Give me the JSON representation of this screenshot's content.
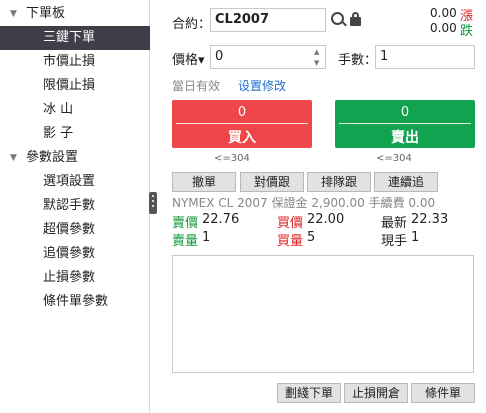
{
  "sidebar": {
    "groups": [
      {
        "label": "下單板",
        "items": [
          "三鍵下單",
          "市價止損",
          "限價止損",
          "冰 山",
          "影 子"
        ]
      },
      {
        "label": "參數設置",
        "items": [
          "選項設置",
          "默認手數",
          "超價參數",
          "追價參數",
          "止損參數",
          "條件單參數"
        ]
      }
    ],
    "selected": "三鍵下單"
  },
  "order": {
    "contract_label": "合約：",
    "contract_value": "CL2007",
    "limit_up_value": "0.00",
    "limit_up_label": "漲",
    "limit_down_value": "0.00",
    "limit_down_label": "跌",
    "price_type_label": "價格▾",
    "price_value": "0",
    "qty_label": "手數：",
    "qty_value": "1",
    "validity_text": "當日有效",
    "settings_link": "设置修改",
    "buy": {
      "qty": "0",
      "label": "買入",
      "hint": "<=304"
    },
    "sell": {
      "qty": "0",
      "label": "賣出",
      "hint": "<=304"
    }
  },
  "toolbar": [
    "撤單",
    "對價跟",
    "排隊跟",
    "連續追"
  ],
  "quote": {
    "info": "NYMEX CL 2007  保證金 2,900.00  手續費 0.00",
    "bid_price_label": "賣價",
    "bid_price": "22.76",
    "bid_qty_label": "賣量",
    "bid_qty": "1",
    "ask_price_label": "買價",
    "ask_price": "22.00",
    "ask_qty_label": "買量",
    "ask_qty": "5",
    "last_label": "最新",
    "last_value": "22.33",
    "volume_label": "現手",
    "volume_value": "1"
  },
  "bottom_buttons": [
    "劃綫下單",
    "止損開倉",
    "條件單"
  ]
}
